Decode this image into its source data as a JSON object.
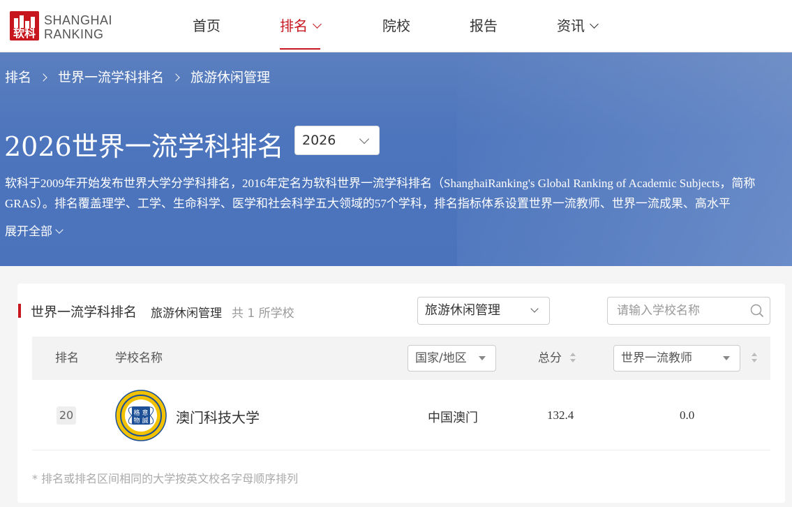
{
  "brand": {
    "logo_mark_text": "软科",
    "logo_line1": "SHANGHAI",
    "logo_line2": "RANKING",
    "red": "#c8161e",
    "banner_blue": "#4d75bd"
  },
  "nav": {
    "items": [
      {
        "label": "首页",
        "has_dropdown": false,
        "active": false
      },
      {
        "label": "排名",
        "has_dropdown": true,
        "active": true
      },
      {
        "label": "院校",
        "has_dropdown": false,
        "active": false
      },
      {
        "label": "报告",
        "has_dropdown": false,
        "active": false
      },
      {
        "label": "资讯",
        "has_dropdown": true,
        "active": false
      }
    ]
  },
  "breadcrumb": [
    "排名",
    "世界一流学科排名",
    "旅游休闲管理"
  ],
  "banner": {
    "title": "2026世界一流学科排名",
    "year_selected": "2026",
    "description": "软科于2009年开始发布世界大学分学科排名，2016年定名为软科世界一流学科排名（ShanghaiRanking's Global Ranking of Academic Subjects，简称GRAS）。排名覆盖理学、工学、生命科学、医学和社会科学五大领域的57个学科，排名指标体系设置世界一流教师、世界一流成果、高水平",
    "expand_label": "展开全部"
  },
  "ranking": {
    "title": "世界一流学科排名",
    "subject": "旅游休闲管理",
    "count_text": "共 1 所学校",
    "subject_select": "旅游休闲管理",
    "search_placeholder": "请输入学校名称",
    "columns": {
      "rank": "排名",
      "name": "学校名称",
      "region": "国家/地区",
      "score": "总分",
      "indicator": "世界一流教师"
    },
    "rows": [
      {
        "rank": "20",
        "name": "澳门科技大学",
        "region": "中国澳门",
        "score": "132.4",
        "indicator": "0.0",
        "logo_chars": [
          "格",
          "意",
          "物",
          "誠"
        ]
      }
    ],
    "footnote": "* 排名或排名区间相同的大学按英文校名字母顺序排列"
  }
}
